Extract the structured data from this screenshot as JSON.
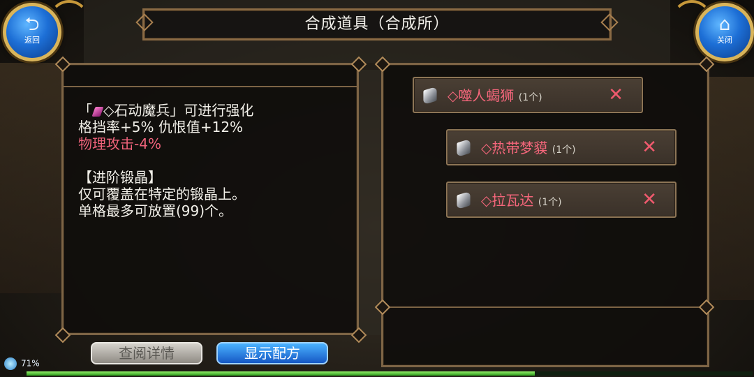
{
  "header": {
    "title": "合成道具（合成所）",
    "back_label": "返回",
    "close_label": "关闭"
  },
  "description": {
    "line1_prefix": "「",
    "line1_item": "◇石动魔兵",
    "line1_suffix": "」可进行强化",
    "line2": "格挡率+5% 仇恨值+12%",
    "line3": "物理攻击-4%",
    "line4": "【进阶锻晶】",
    "line5": "仅可覆盖在特定的锻晶上。",
    "line6": "单格最多可放置(99)个。"
  },
  "materials": [
    {
      "name": "◇噬人蝎狮",
      "count": "(1个)",
      "remove": "✕"
    },
    {
      "name": "◇热带梦貘",
      "count": "(1个)",
      "remove": "✕"
    },
    {
      "name": "◇拉瓦达",
      "count": "(1个)",
      "remove": "✕"
    }
  ],
  "buttons": {
    "details": "查阅详情",
    "recipe": "显示配方"
  },
  "status": {
    "battery": "71%",
    "progress_fraction": 0.7
  },
  "colors": {
    "accent_red": "#f0637b",
    "button_blue": "#1d6fd6",
    "frame_brown": "#7d6445"
  },
  "icons": {
    "back": "back-arrow-icon",
    "close": "home-icon",
    "gem": "crystal-icon"
  }
}
